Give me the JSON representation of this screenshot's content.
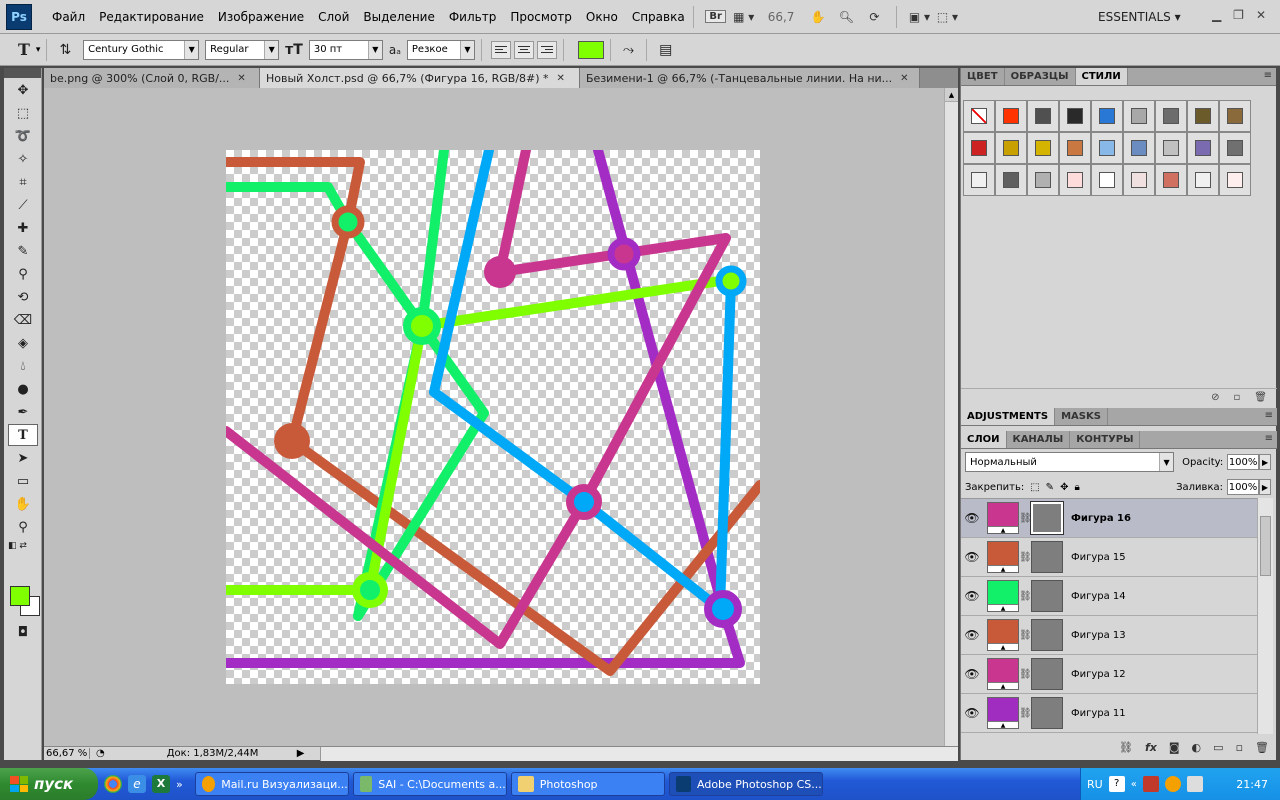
{
  "menubar": {
    "logo": "Ps",
    "items": [
      "Файл",
      "Редактирование",
      "Изображение",
      "Слой",
      "Выделение",
      "Фильтр",
      "Просмотр",
      "Окно",
      "Справка"
    ],
    "bridge_label": "Br",
    "zoom": "66,7",
    "workspace": "ESSENTIALS"
  },
  "options": {
    "font_family": "Century Gothic",
    "font_style": "Regular",
    "font_size": "30 пт",
    "antialias_prefix": "a",
    "antialias": "Резкое",
    "text_color": "#7fff00"
  },
  "tabs": [
    {
      "label": "be.png @ 300% (Слой 0, RGB/..."
    },
    {
      "label": "Новый Холст.psd @ 66,7% (Фигура 16, RGB/8#) *"
    },
    {
      "label": "Безимени-1 @ 66,7% (-Танцевальные линии. На ни..."
    }
  ],
  "status": {
    "zoom": "66,67 %",
    "doc": "Док: 1,83М/2,44М"
  },
  "tools": {
    "foreground_color": "#7fff00",
    "background_color": "#ffffff"
  },
  "styles_panel": {
    "tabs": [
      "ЦВЕТ",
      "ОБРАЗЦЫ",
      "СТИЛИ"
    ],
    "active_tab": "СТИЛИ",
    "swatches": [
      "#ffffff",
      "#ff3300",
      "#505050",
      "#2a2a2a",
      "#2a78d6",
      "#a8a8a8",
      "#6c6c6c",
      "#6b5a2a",
      "#8a6a3a",
      "#cc2222",
      "#c8a000",
      "#d4b400",
      "#c87840",
      "#88b8e8",
      "#6a8cc0",
      "#c0c0c0",
      "#7a6ab0",
      "#707070",
      "#f0f0f0",
      "#606060",
      "#b0b0b0",
      "#ffdcdc",
      "#ffffff",
      "#f0e0e0",
      "#d07060",
      "#f0f0f0",
      "#ffeeee"
    ]
  },
  "adjust_tabs": [
    "ADJUSTMENTS",
    "MASKS"
  ],
  "layers_panel": {
    "tabs": [
      "СЛОИ",
      "КАНАЛЫ",
      "КОНТУРЫ"
    ],
    "blend_mode": "Нормальный",
    "opacity_label": "Opacity:",
    "opacity": "100%",
    "lock_label": "Закрепить:",
    "fill_label": "Заливка:",
    "fill": "100%",
    "layers": [
      {
        "name": "Фигура 16",
        "color": "#c8368f",
        "selected": true
      },
      {
        "name": "Фигура 15",
        "color": "#c85a3a",
        "selected": false
      },
      {
        "name": "Фигура 14",
        "color": "#12f06a",
        "selected": false
      },
      {
        "name": "Фигура 13",
        "color": "#c85a3a",
        "selected": false
      },
      {
        "name": "Фигура 12",
        "color": "#c8368f",
        "selected": false
      },
      {
        "name": "Фигура 11",
        "color": "#a02cc0",
        "selected": false
      }
    ]
  },
  "taskbar": {
    "start": "пуск",
    "tasks": [
      {
        "label": "Mail.ru Визуализаци...",
        "color": "#f4a000"
      },
      {
        "label": "SAI - C:\\Documents a...",
        "color": "#7ab96a"
      },
      {
        "label": "Photoshop",
        "color": "#f0d070"
      },
      {
        "label": "Adobe Photoshop CS...",
        "color": "#0a3c72"
      }
    ],
    "lang": "RU",
    "time": "21:47"
  }
}
